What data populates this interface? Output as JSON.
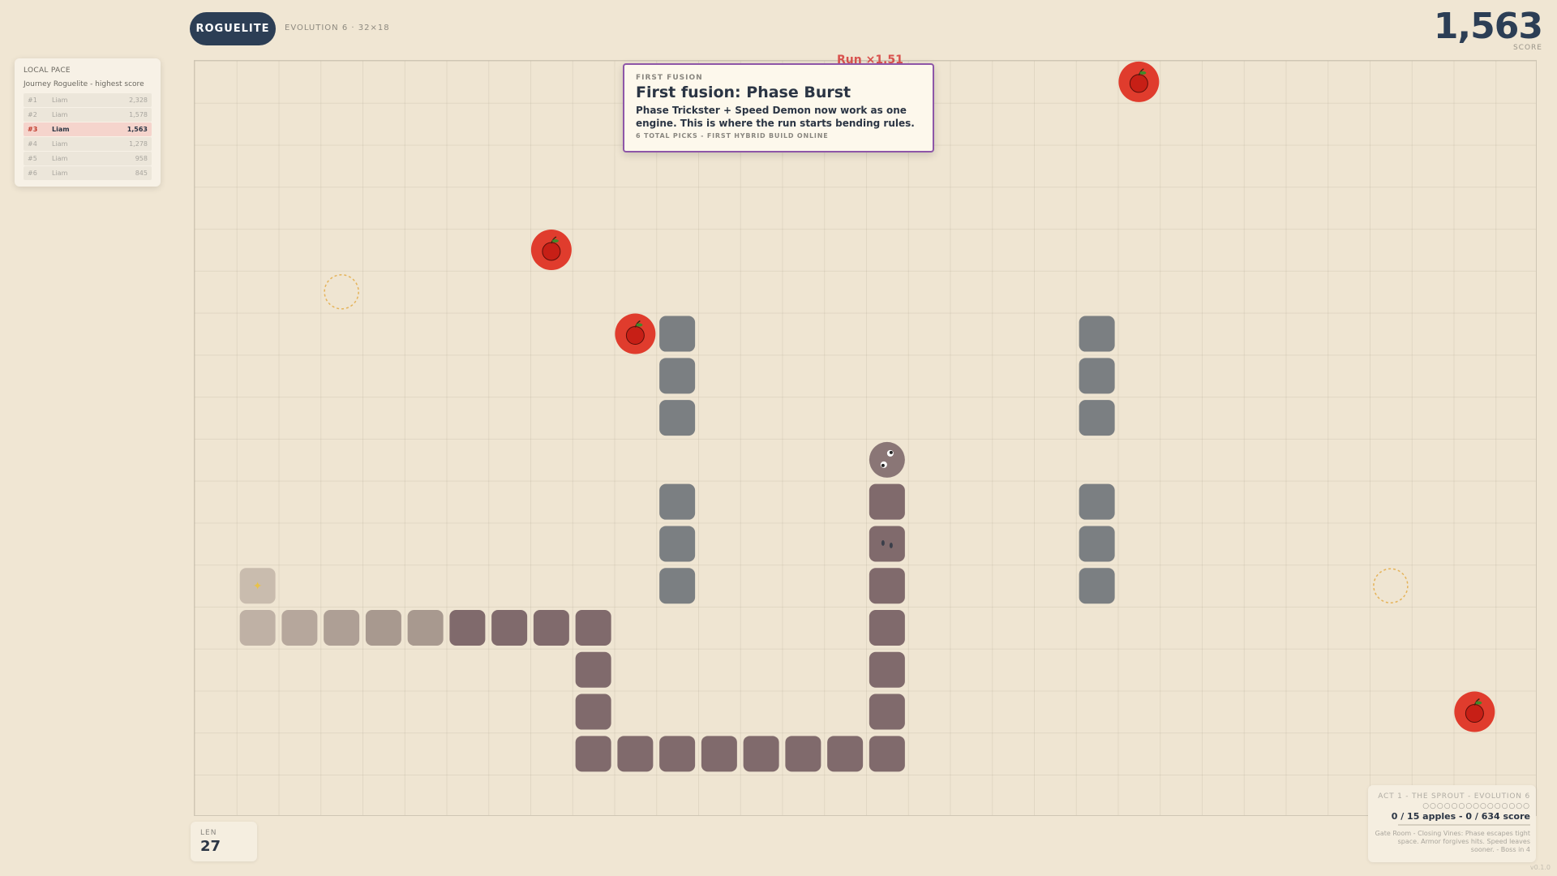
{
  "header": {
    "mode": "ROGUELITE",
    "evolution": "EVOLUTION 6 · 32×18",
    "score_value": "1,563",
    "score_label": "SCORE"
  },
  "leaderboard": {
    "title": "LOCAL PACE",
    "subtitle": "Journey Roguelite - highest score",
    "rows": [
      {
        "rank": "#1",
        "name": "Liam",
        "score": "2,328"
      },
      {
        "rank": "#2",
        "name": "Liam",
        "score": "1,578"
      },
      {
        "rank": "#3",
        "name": "Liam",
        "score": "1,563"
      },
      {
        "rank": "#4",
        "name": "Liam",
        "score": "1,278"
      },
      {
        "rank": "#5",
        "name": "Liam",
        "score": "958"
      },
      {
        "rank": "#6",
        "name": "Liam",
        "score": "845"
      }
    ]
  },
  "run_multiplier": "Run ×1.51",
  "toast": {
    "kicker": "FIRST FUSION",
    "heading": "First fusion: Phase Burst",
    "body": "Phase Trickster + Speed Demon now work as one engine. This is where the run starts bending rules.",
    "meta": "6 TOTAL PICKS - FIRST HYBRID BUILD ONLINE"
  },
  "len": {
    "label": "LEN",
    "value": "27"
  },
  "act": {
    "title": "ACT 1 - THE SPROUT - EVOLUTION 6",
    "dots": "○○○○○○○○○○○○○○○",
    "progress": "0 / 15 apples - 0 / 634 score",
    "progress_fraction": 0,
    "desc": "Gate Room - Closing Vines: Phase escapes tight space. Armor forgives hits. Speed leaves sooner. - Boss in 4"
  },
  "version": "v0.1.0",
  "colors": {
    "apple": "#e03c2d",
    "wall": "#7b7f82",
    "snake_dark": "#806a6c",
    "snake_light": "#a8998f",
    "pill": "#2c3e55",
    "toast_border": "#8e56a8"
  },
  "board": {
    "cols": 32,
    "rows": 18,
    "apples": [
      [
        22,
        0
      ],
      [
        8,
        4
      ],
      [
        10,
        6
      ],
      [
        30,
        15
      ]
    ],
    "walls": [
      [
        11,
        6
      ],
      [
        11,
        7
      ],
      [
        11,
        8
      ],
      [
        11,
        10
      ],
      [
        11,
        11
      ],
      [
        11,
        12
      ],
      [
        21,
        6
      ],
      [
        21,
        7
      ],
      [
        21,
        8
      ],
      [
        21,
        10
      ],
      [
        21,
        11
      ],
      [
        21,
        12
      ]
    ],
    "snake_head": [
      16,
      9
    ],
    "snake_body": [
      [
        16,
        10
      ],
      [
        16,
        11
      ],
      [
        16,
        12
      ],
      [
        16,
        13
      ],
      [
        16,
        14
      ],
      [
        16,
        15
      ],
      [
        16,
        16
      ],
      [
        15,
        16
      ],
      [
        14,
        16
      ],
      [
        13,
        16
      ],
      [
        12,
        16
      ],
      [
        11,
        16
      ],
      [
        10,
        16
      ],
      [
        9,
        16
      ],
      [
        9,
        15
      ],
      [
        9,
        14
      ],
      [
        9,
        13
      ],
      [
        8,
        13
      ],
      [
        7,
        13
      ],
      [
        6,
        13
      ],
      [
        5,
        13
      ],
      [
        4,
        13
      ],
      [
        3,
        13
      ],
      [
        2,
        13
      ],
      [
        1,
        13
      ],
      [
        1,
        12
      ]
    ],
    "portals": [
      [
        3,
        5
      ],
      [
        28,
        12
      ]
    ]
  }
}
